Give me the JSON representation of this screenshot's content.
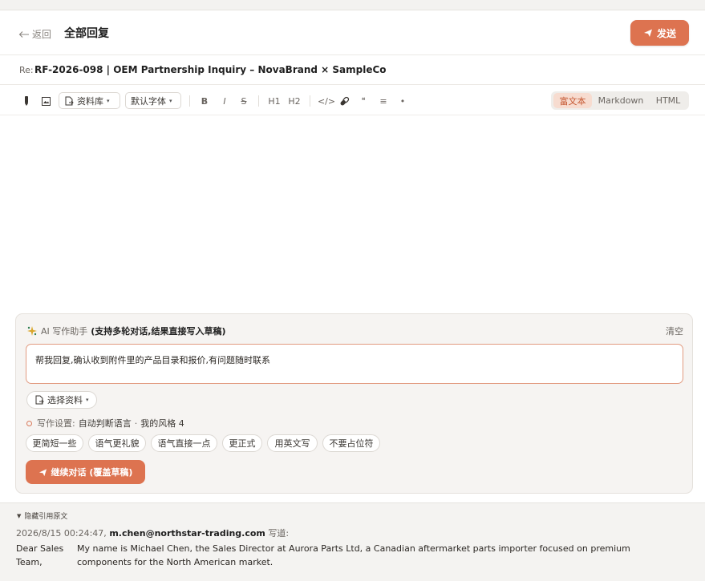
{
  "header": {
    "back_label": "返回",
    "title": "全部回复",
    "send_label": "发送"
  },
  "subject": {
    "prefix": "Re:",
    "text": "RF-2026-098 | OEM Partnership Inquiry – NovaBrand × SampleCo"
  },
  "toolbar": {
    "library_label": "资料库",
    "font_label": "默认字体",
    "bold": "B",
    "italic": "I",
    "strike": "S",
    "h1": "H1",
    "h2": "H2",
    "code": "</>",
    "quote": "❝",
    "list": "≡",
    "bullet": "•",
    "modes": [
      "富文本",
      "Markdown",
      "HTML"
    ],
    "active_mode": "富文本"
  },
  "ai": {
    "label": "AI 写作助手",
    "label_bold": "(支持多轮对话,结果直接写入草稿)",
    "clear_label": "清空",
    "prompt_value": "帮我回复,确认收到附件里的产品目录和报价,有问题随时联系",
    "select_material_label": "选择资料",
    "settings_label": "写作设置:",
    "settings_language": "自动判断语言",
    "settings_sep": "·",
    "settings_style": "我的风格 4",
    "chips": [
      "更简短一些",
      "语气更礼貌",
      "语气直接一点",
      "更正式",
      "用英文写",
      "不要占位符"
    ],
    "continue_label": "继续对话 (覆盖草稿)"
  },
  "quote": {
    "toggle_label": "隐藏引用原文",
    "timestamp": "2026/8/15 00:24:47,",
    "sender": "m.chen@northstar-trading.com",
    "wrote": "写道:",
    "greeting": "Dear Sales Team,",
    "body": "My name is Michael Chen, the Sales Director at Aurora Parts Ltd, a Canadian aftermarket parts importer focused on premium components for the North American market."
  },
  "colors": {
    "accent": "#dd7350",
    "accent_light": "#f7dcd0",
    "panel_bg": "#f6f4f2"
  }
}
